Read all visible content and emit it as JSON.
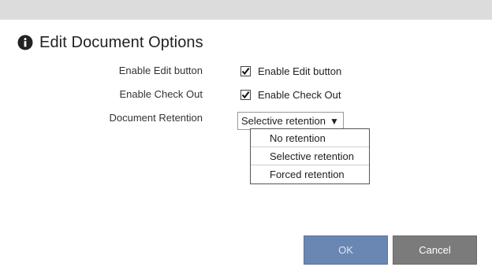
{
  "dialog": {
    "title": "Edit Document Options",
    "icon": "info-icon"
  },
  "options": {
    "edit_button": {
      "label": "Enable Edit button",
      "checkbox_label": "Enable Edit button",
      "checked": true
    },
    "check_out": {
      "label": "Enable Check Out",
      "checkbox_label": "Enable Check Out",
      "checked": true
    },
    "retention": {
      "label": "Document Retention",
      "selected": "Selective retention",
      "arrow": "▼",
      "options": [
        "No retention",
        "Selective retention",
        "Forced retention"
      ]
    }
  },
  "buttons": {
    "ok": "OK",
    "cancel": "Cancel"
  },
  "colors": {
    "top_bar": "#dcdcdc",
    "ok_button": "#6a86b3",
    "cancel_button": "#7b7b7b"
  }
}
